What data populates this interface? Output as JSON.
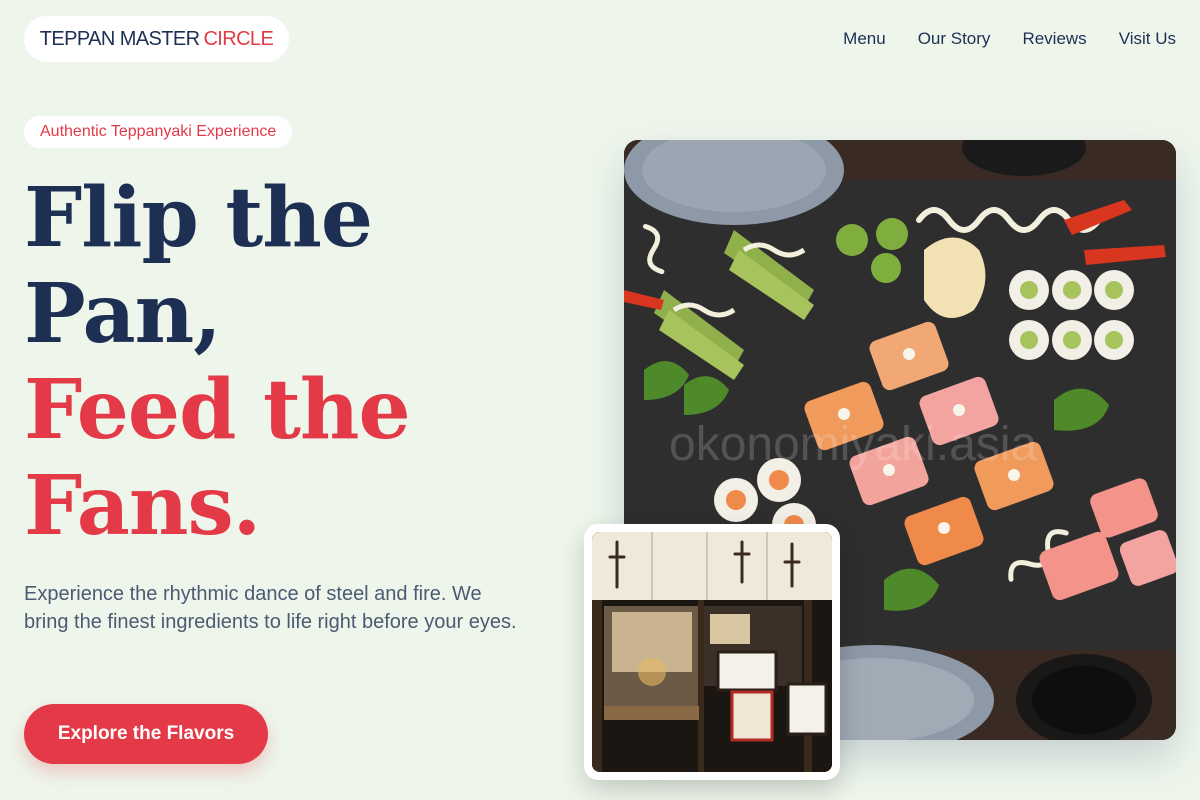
{
  "header": {
    "logo_primary": "TEPPAN MASTER",
    "logo_accent": "CIRCLE",
    "nav": [
      "Menu",
      "Our Story",
      "Reviews",
      "Visit Us"
    ]
  },
  "hero": {
    "badge": "Authentic Teppanyaki Experience",
    "headline_lines": [
      "Flip the",
      "Pan,",
      "Feed the",
      "Fans."
    ],
    "subtext": "Experience the rhythmic dance of steel and fire. We bring the finest ingredients to life right before your eyes.",
    "cta_label": "Explore the Flavors"
  },
  "images": {
    "main": "sushi-platter-photo",
    "inset": "restaurant-storefront-photo",
    "watermark": "okonomiyaki.asia"
  },
  "colors": {
    "background": "#eef6ec",
    "navy": "#1e2f54",
    "accent": "#e43a47",
    "body_text": "#4b5a72"
  }
}
